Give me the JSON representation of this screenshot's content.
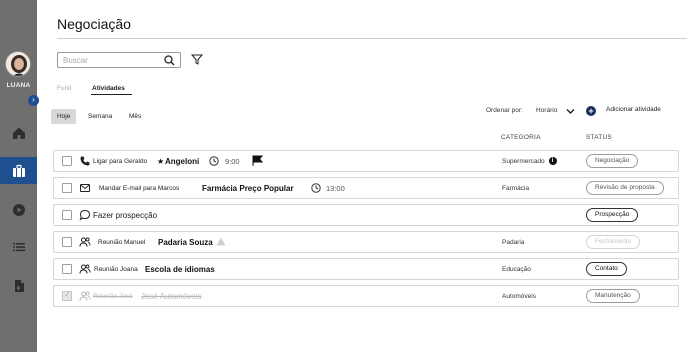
{
  "user": {
    "name": "LUANA"
  },
  "sidebar": {
    "items": [
      {
        "id": "home",
        "icon": "home-icon"
      },
      {
        "id": "negociacao",
        "icon": "briefcase-icon",
        "active": true
      },
      {
        "id": "play",
        "icon": "play-circle-icon"
      },
      {
        "id": "list",
        "icon": "list-icon"
      },
      {
        "id": "document",
        "icon": "document-icon"
      }
    ]
  },
  "header": {
    "title": "Negociação"
  },
  "search": {
    "placeholder": "Buscar",
    "value": ""
  },
  "tabs": [
    {
      "label": "Funil",
      "active": false
    },
    {
      "label": "Atividades",
      "active": true
    }
  ],
  "periods": [
    {
      "label": "Hoje",
      "active": true
    },
    {
      "label": "Semana",
      "active": false
    },
    {
      "label": "Mês",
      "active": false
    }
  ],
  "sort": {
    "label": "Ordenar por:",
    "value": "Horário"
  },
  "add_activity": {
    "label": "Adicionar atividade"
  },
  "columns": {
    "category": "CATEGORIA",
    "status": "STATUS"
  },
  "activities": [
    {
      "type_icon": "phone-icon",
      "title": "Ligar para Geraldo",
      "company": "Angeloni",
      "starred": true,
      "time": "9:00",
      "flagged": true,
      "category": "Supermercado",
      "category_info": "i",
      "status": "Negociação",
      "status_style": "normal",
      "done": false
    },
    {
      "type_icon": "mail-icon",
      "title": "Mandar E-mail para Marcos",
      "company": "Farmácia Preço Popular",
      "time": "13:00",
      "category": "Farmácia",
      "status": "Revisão de proposta",
      "status_style": "normal",
      "done": false
    },
    {
      "type_icon": "chat-icon",
      "title": "Fazer prospecção",
      "company": "",
      "category": "",
      "status": "Prospecção",
      "status_style": "dark",
      "done": false
    },
    {
      "type_icon": "people-icon",
      "title": "Reunião Manuel",
      "company": "Padaria Souza",
      "warning": true,
      "category": "Padaria",
      "status": "Fechamento",
      "status_style": "faded",
      "done": false
    },
    {
      "type_icon": "people-icon",
      "title": "Reunião Joana",
      "company": "Escola de idiomas",
      "category": "Educação",
      "status": "Contato",
      "status_style": "dark",
      "done": false
    },
    {
      "type_icon": "people-icon",
      "title": "Reunião José",
      "company": "José Automóveis",
      "category": "Automóveis",
      "status": "Manutenção",
      "status_style": "normal",
      "done": true
    }
  ]
}
